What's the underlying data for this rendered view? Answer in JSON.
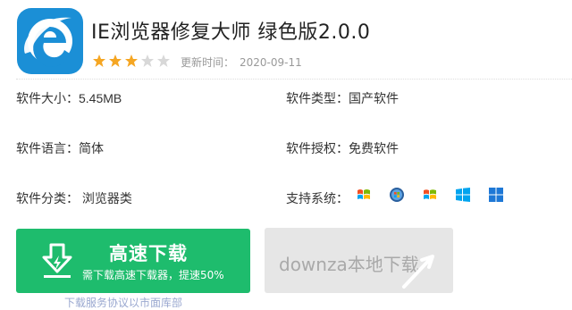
{
  "header": {
    "app_icon": "internet-explorer-logo",
    "title": "IE浏览器修复大师 绿色版2.0.0",
    "rating": {
      "filled": 3,
      "total": 5
    },
    "updated_label": "更新时间：",
    "updated_value": "2020-09-11"
  },
  "info": {
    "size": "软件大小：5.45MB",
    "type": "软件类型：国产软件",
    "language": "软件语言：简体",
    "license": "软件授权：免费软件",
    "category": "软件分类： 浏览器类",
    "systems": "支持系统：",
    "os_icons": [
      "windows-xp-icon",
      "windows-vista-icon",
      "windows-7-icon",
      "windows-8-icon",
      "windows-10-icon"
    ]
  },
  "buttons": {
    "fast_download": "高速下载",
    "fast_download_sub": "需下载高速下载器，提速50%",
    "local_download": "downza本地下载"
  },
  "footer": {
    "note": "下载服务协议以市面库部"
  },
  "colors": {
    "download_green": "#1ebc6d",
    "star_gold": "#f5a623",
    "star_gray": "#d8d8d8",
    "ie_blue": "#1b8fd6"
  }
}
